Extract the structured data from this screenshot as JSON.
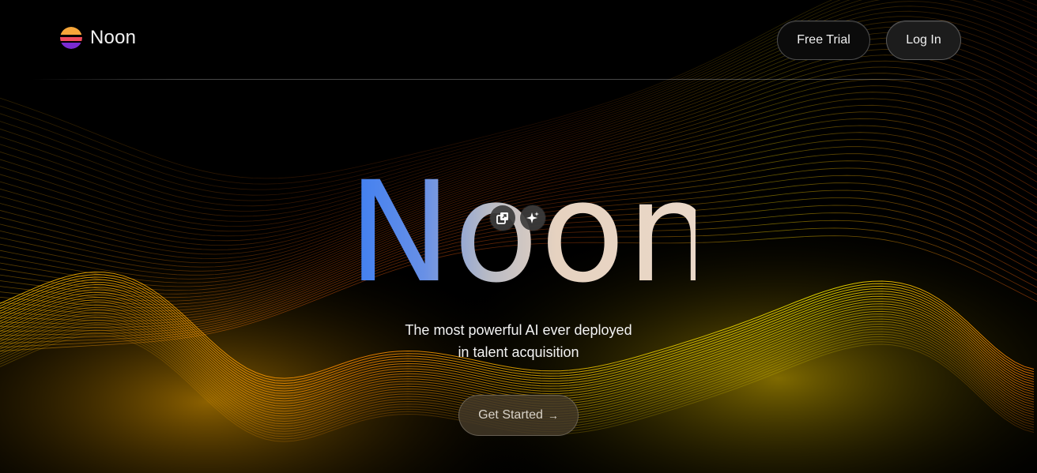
{
  "brand": {
    "name": "Noon",
    "logo_icon": "sunset-logo-icon"
  },
  "nav": {
    "free_trial_label": "Free Trial",
    "login_label": "Log In"
  },
  "hero": {
    "title": "Noon",
    "subtitle_line1": "The most powerful AI ever deployed",
    "subtitle_line2": "in talent acquisition",
    "cta_label": "Get Started",
    "cta_arrow": "→"
  },
  "overlay_icons": [
    "copy-icon",
    "sparkle-icon"
  ],
  "colors": {
    "background": "#000000",
    "wave_primary": "#f5e400",
    "wave_secondary": "#d9560a",
    "title_gradient_start": "#3d7ef2",
    "title_gradient_end": "#ead8c8"
  }
}
